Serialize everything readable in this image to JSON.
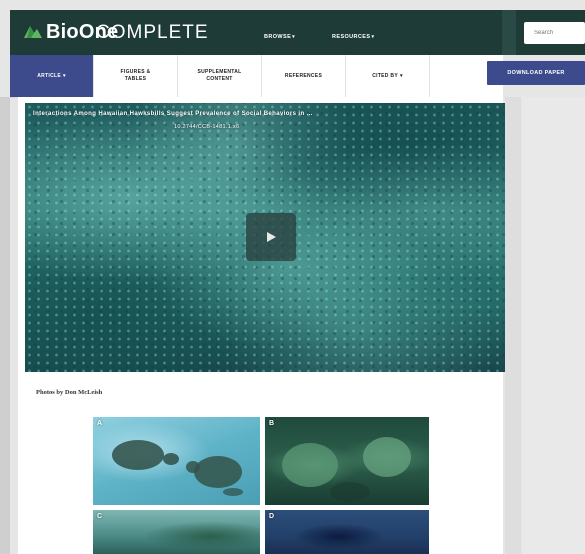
{
  "header": {
    "brand_bold": "BioOne",
    "brand_light": "COMPLETE",
    "nav": [
      {
        "label": "BROWSE"
      },
      {
        "label": "RESOURCES"
      }
    ],
    "search_placeholder": "Search",
    "colors": {
      "header_bg": "#1f3b37",
      "accent": "#3d4a8c",
      "logo_green": "#5db860"
    }
  },
  "tabs": [
    {
      "label": "ARTICLE",
      "active": true,
      "has_caret": true
    },
    {
      "label_line1": "FIGURES &",
      "label_line2": "TABLES"
    },
    {
      "label_line1": "SUPPLEMENTAL",
      "label_line2": "CONTENT"
    },
    {
      "label": "REFERENCES"
    },
    {
      "label": "CITED BY",
      "has_caret": true
    }
  ],
  "download_label": "DOWNLOAD PAPER",
  "video": {
    "title": "Interactions Among Hawaiian Hawksbills Suggest Prevalence of Social Behaviors in ...",
    "doi": "10.2744/CCB-1481.1.s6",
    "play_icon": "play-icon"
  },
  "caption": "Photos by Don McLeish",
  "photos": [
    {
      "label": "A"
    },
    {
      "label": "B"
    },
    {
      "label": "C"
    },
    {
      "label": "D"
    }
  ]
}
